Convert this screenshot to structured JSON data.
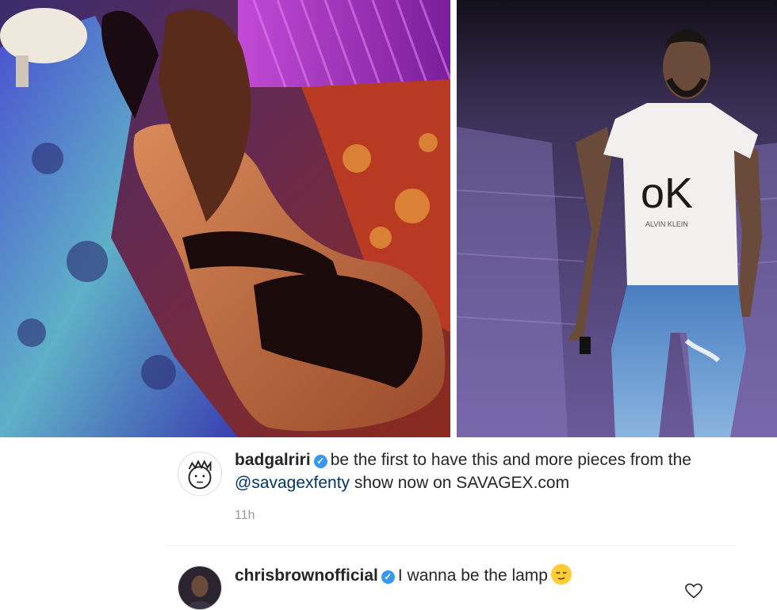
{
  "post": {
    "images": [
      {
        "name": "rihanna-photo"
      },
      {
        "name": "chris-brown-photo",
        "shirt_text": "oK",
        "shirt_subtext": "ALVIN KLEIN"
      }
    ]
  },
  "comments": [
    {
      "username": "badgalriri",
      "text_before": "be the first to have this and more pieces from the ",
      "mention": "@savagexfenty",
      "text_after": " show now on SAVAGEX.com",
      "time": "11h"
    },
    {
      "username": "chrisbrownofficial",
      "text": "I wanna be the lamp",
      "emoji": "relieved-face"
    }
  ],
  "colors": {
    "verified": "#3897f0",
    "mention": "#003569",
    "text": "#262626",
    "muted": "#999999"
  }
}
